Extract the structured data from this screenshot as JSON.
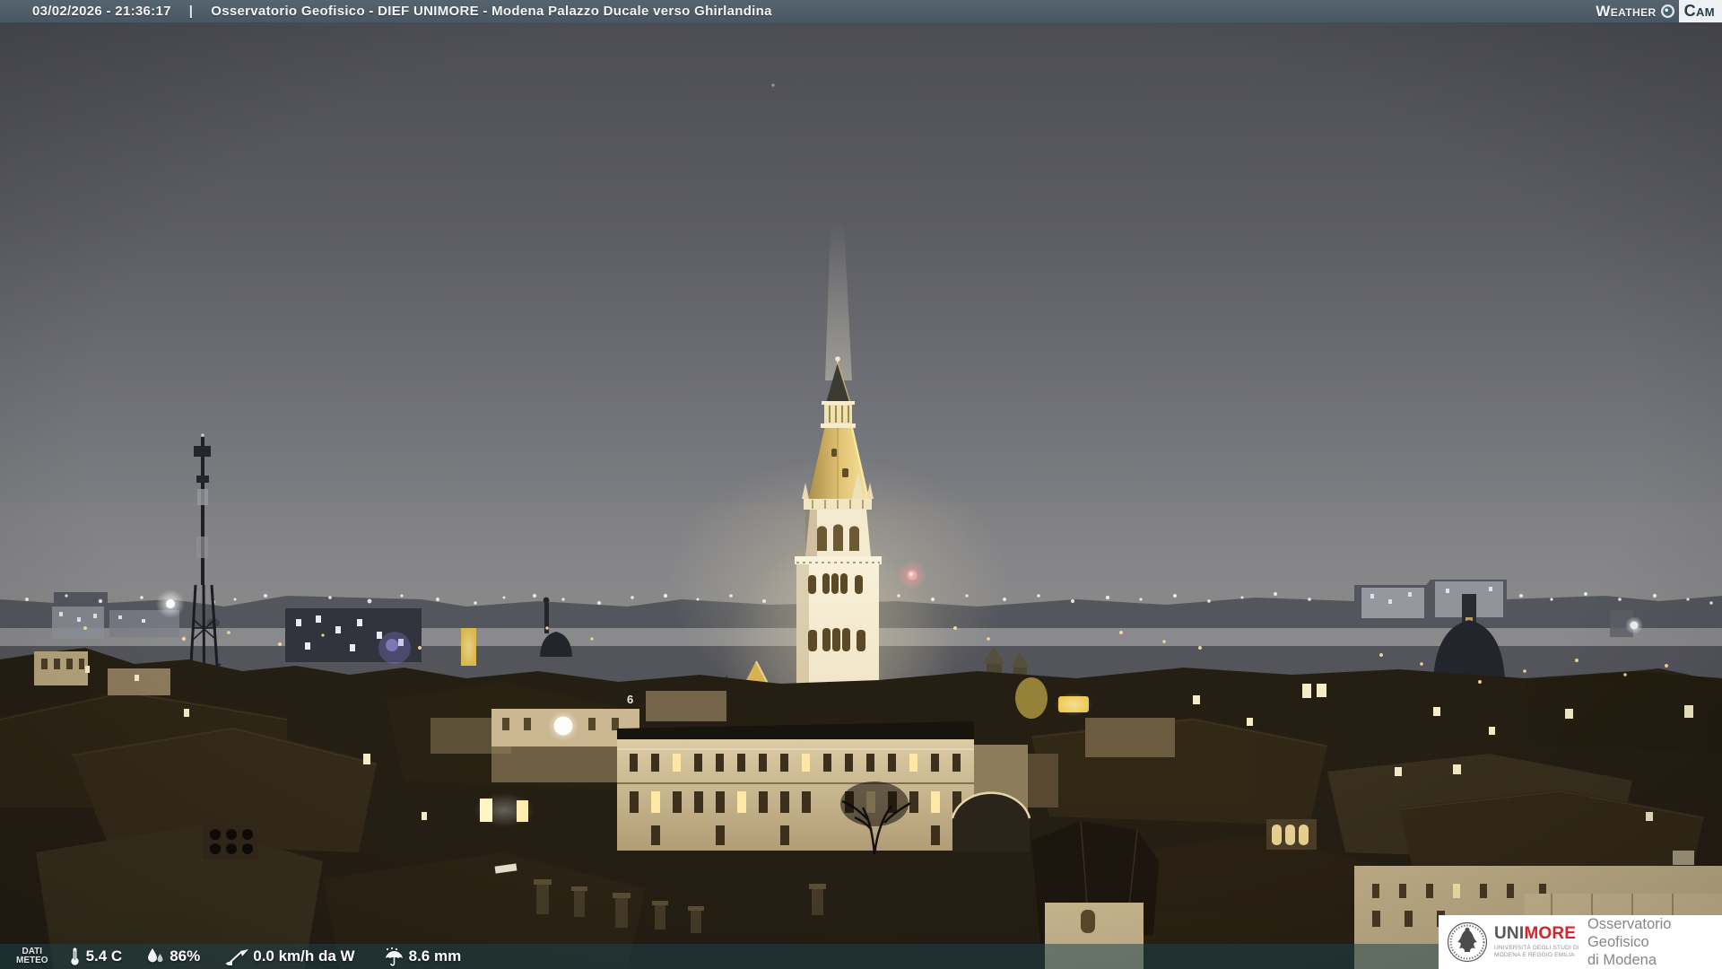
{
  "header": {
    "datetime": "03/02/2026 - 21:36:17",
    "separator": "|",
    "title": "Osservatorio Geofisico - DIEF UNIMORE - Modena Palazzo Ducale verso Ghirlandina",
    "brand": {
      "weather": "Weather",
      "cam": "Cam"
    }
  },
  "scene": {
    "house_number": "6",
    "colors": {
      "header_bg": "#4e5c6a",
      "sky_top": "#4b4c52",
      "sky_horizon": "#8b8b8d",
      "tower_light": "#f6eed8",
      "spire_gold": "#e3c474",
      "warning_light": "#ed9fab",
      "window_glow": "#ffe8a6",
      "footer_tint": "#1c424c",
      "brand_red": "#d0272e"
    }
  },
  "footer": {
    "label_line1": "DATI",
    "label_line2": "METEO",
    "temperature": "5.4 C",
    "humidity": "86%",
    "wind": "0.0 km/h da W",
    "rain": "8.6 mm"
  },
  "logo_box": {
    "wordmark_uni": "UNI",
    "wordmark_more": "MORE",
    "subtitle_line1": "UNIVERSITÀ DEGLI STUDI DI",
    "subtitle_line2": "MODENA E REGGIO EMILIA",
    "org_line1": "Osservatorio Geofisico",
    "org_line2": "di Modena"
  }
}
